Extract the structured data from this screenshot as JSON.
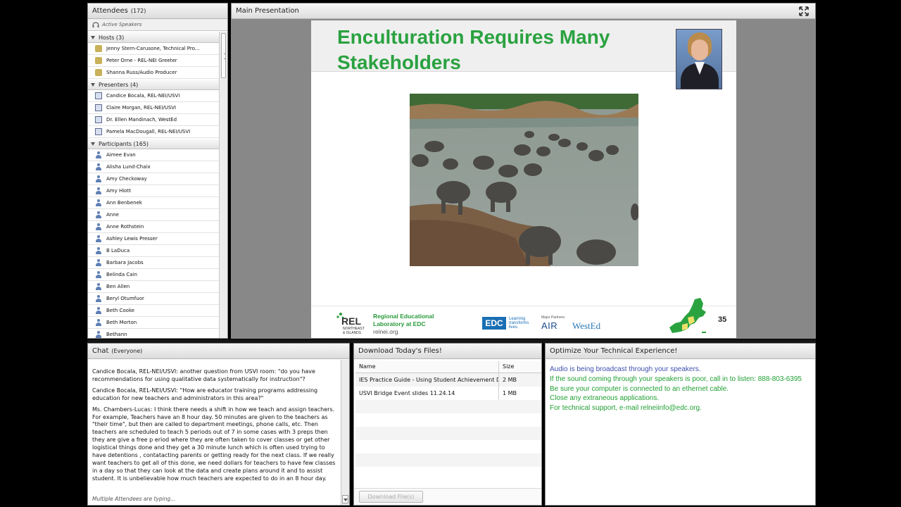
{
  "attendees": {
    "title": "Attendees",
    "count": "(172)",
    "active_speakers": "Active Speakers",
    "groups": [
      {
        "label": "Hosts (3)",
        "role": "host",
        "members": [
          "Jenny Stern-Carusone, Technical Pro...",
          "Peter Orne - REL-NEI Greeter",
          "Shanna Russ/Audio Producer"
        ]
      },
      {
        "label": "Presenters (4)",
        "role": "presenter",
        "members": [
          "Candice Bocala, REL-NEI/USVI",
          "Claire Morgan, REL-NEI/USVI",
          "Dr. Ellen Mandinach, WestEd",
          "Pamela MacDougall, REL-NEI/USVI"
        ]
      },
      {
        "label": "Participants (165)",
        "role": "participant",
        "members": [
          "Aimee Evan",
          "Alisha Lund-Chaix",
          "Amy Checkoway",
          "Amy Hiott",
          "Ann Benbenek",
          "Anne",
          "Anne Rothstein",
          "Ashley Lewis Presser",
          "B LaDuca",
          "Barbara Jacobs",
          "Belinda Cain",
          "Ben Allen",
          "Beryl Otumfuor",
          "Beth Cooke",
          "Beth Morton",
          "Bethann"
        ]
      }
    ]
  },
  "presentation": {
    "title": "Main Presentation",
    "slide": {
      "heading": "Enculturation Requires Many Stakeholders",
      "rel_badge_line1": "REL",
      "rel_badge_line2": "NORTHEAST",
      "rel_badge_line3": "& ISLANDS",
      "rel_name_line1": "Regional Educational",
      "rel_name_line2": "Laboratory at EDC",
      "rel_url": "relnei.org",
      "edc_logo": "EDC",
      "edc_tagline_1": "Learning",
      "edc_tagline_2": "transforms",
      "edc_tagline_3": "lives.",
      "partners_label": "Major Partners:",
      "air": "AIR",
      "wested": "WestEd",
      "slide_number": "35"
    }
  },
  "chat": {
    "title": "Chat",
    "scope": "(Everyone)",
    "messages": [
      {
        "sender": "Candice Bocala, REL-NEI/USVI:",
        "text": " another question from USVI room: \"do you have recommendations for using qualitative data systematically for instruction\"?"
      },
      {
        "sender": "Candice Bocala, REL-NEI/USVI:",
        "text": " \"How are educator training programs addressing education for new teachers and administrators in this area?\""
      },
      {
        "sender": "Ms. Chambers-Lucas:",
        "text": " I think there needs  a shift in how we teach and assign teachers. For example, Teachers have an 8 hour day.  50 minutes are given to the teachers as \"their time\", but then are called to department meetings, phone calls, etc.  Then teachers are scheduled to teach 5 periods out of 7 in some cases with  3 preps  then they are give a free p eriod  where they are often taken to cover classes or get other logistical things done and they get a 30 minute lunch which is often used trying to have detentions , contatacting parents or getting ready for the next class.  If we really want teachers to get all of this done, we need dollars for teachers to have few classes in a day so that they can look at the data and create plans around it and to assist student.  It is unbelievable how much teachers are expected to do in an 8 hour day."
      }
    ],
    "typing": "Multiple Attendees are typing..."
  },
  "files": {
    "title": "Download Today's Files!",
    "columns": [
      "Name",
      "Size"
    ],
    "rows": [
      {
        "name": "IES Practice Guide - Using Student Achievement Da",
        "size": "2 MB"
      },
      {
        "name": "USVI Bridge Event slides 11.24.14",
        "size": "1 MB"
      }
    ],
    "download_label": "Download File(s)"
  },
  "optimize": {
    "title": "Optimize Your Technical Experience!",
    "lines": [
      {
        "text": "Audio is being broadcast through your speakers.",
        "color": "blue"
      },
      {
        "text": "If the sound coming through your speakers is poor, call in to listen: 888-803-6395",
        "color": "green"
      },
      {
        "text": "Be sure your computer is connected to an ethernet cable.",
        "color": "green"
      },
      {
        "text": "Close any extraneous applications.",
        "color": "green"
      },
      {
        "text": "For technical support, e-mail relneiinfo@edc.org.",
        "color": "green"
      }
    ]
  },
  "colors": {
    "slide_title": "#2aa240",
    "optimize_blue": "#4050b0",
    "optimize_green": "#21a034"
  }
}
